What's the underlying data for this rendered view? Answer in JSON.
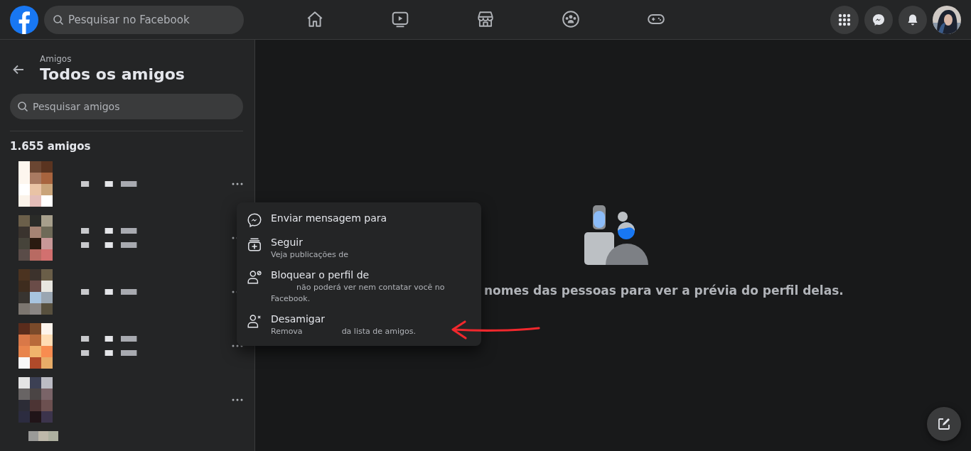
{
  "topbar": {
    "search": {
      "placeholder": "Pesquisar no Facebook"
    },
    "nav": [
      {
        "kind": "home",
        "selected": false
      },
      {
        "kind": "video",
        "selected": false
      },
      {
        "kind": "store",
        "selected": false
      },
      {
        "kind": "groups",
        "selected": false
      },
      {
        "kind": "gaming",
        "selected": false
      }
    ],
    "actions": [
      {
        "kind": "menu"
      },
      {
        "kind": "messenger"
      },
      {
        "kind": "notifications"
      },
      {
        "kind": "avatar"
      }
    ]
  },
  "sidebar": {
    "breadcrumb": "Amigos",
    "title": "Todos os amigos",
    "search": {
      "placeholder": "Pesquisar amigos"
    },
    "count": "1.655 amigos",
    "friends": [
      {
        "kind": "one"
      },
      {
        "kind": "two"
      },
      {
        "kind": "one"
      },
      {
        "kind": "two"
      },
      {
        "kind": "none"
      }
    ]
  },
  "context_menu": [
    {
      "kind": "messenger",
      "title": "Enviar mensagem para"
    },
    {
      "kind": "follow",
      "title": "Seguir",
      "subtitle": [
        "Veja publicações de"
      ]
    },
    {
      "kind": "block",
      "title": "Bloquear o perfil de",
      "subtitle": [
        "não poderá ver nem contatar você no Facebook."
      ],
      "starts_redacted": true
    },
    {
      "kind": "unfriend",
      "title": "Desamigar",
      "subtitle": [
        "Remova",
        "da lista de amigos."
      ]
    }
  ],
  "main": {
    "message": "nomes das pessoas para ver a prévia do perfil delas."
  }
}
